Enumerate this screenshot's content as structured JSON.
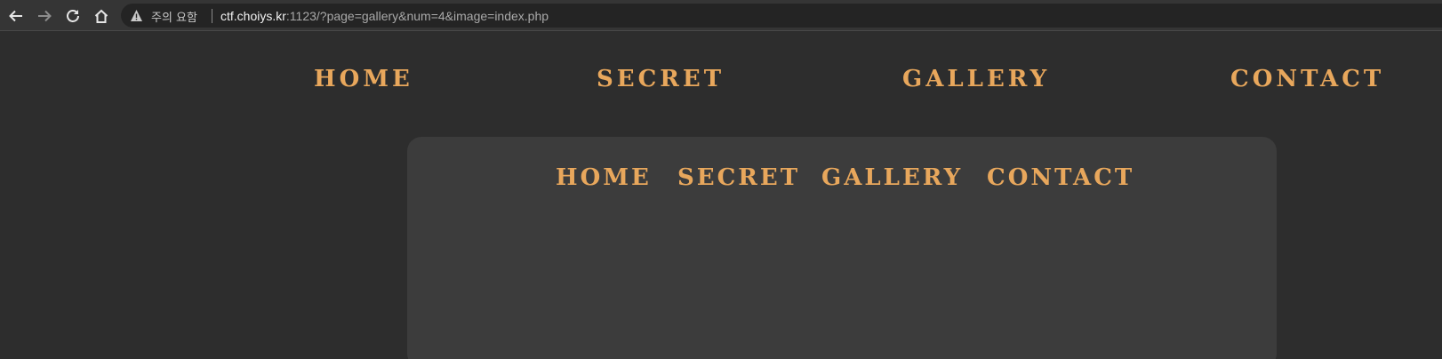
{
  "browser": {
    "warning_label": "주의 요함",
    "url_host": "ctf.choiys.kr",
    "url_rest": ":1123/?page=gallery&num=4&image=index.php"
  },
  "outer_nav": {
    "home": "HOME",
    "secret": "SECRET",
    "gallery": "GALLERY",
    "contact": "CONTACT"
  },
  "inner_nav": {
    "home": "HOME",
    "secret": "SECRET",
    "gallery": "GALLERY",
    "contact": "CONTACT"
  },
  "colors": {
    "accent": "#e8a75c",
    "background": "#2d2d2d",
    "frame": "#3c3c3c"
  }
}
